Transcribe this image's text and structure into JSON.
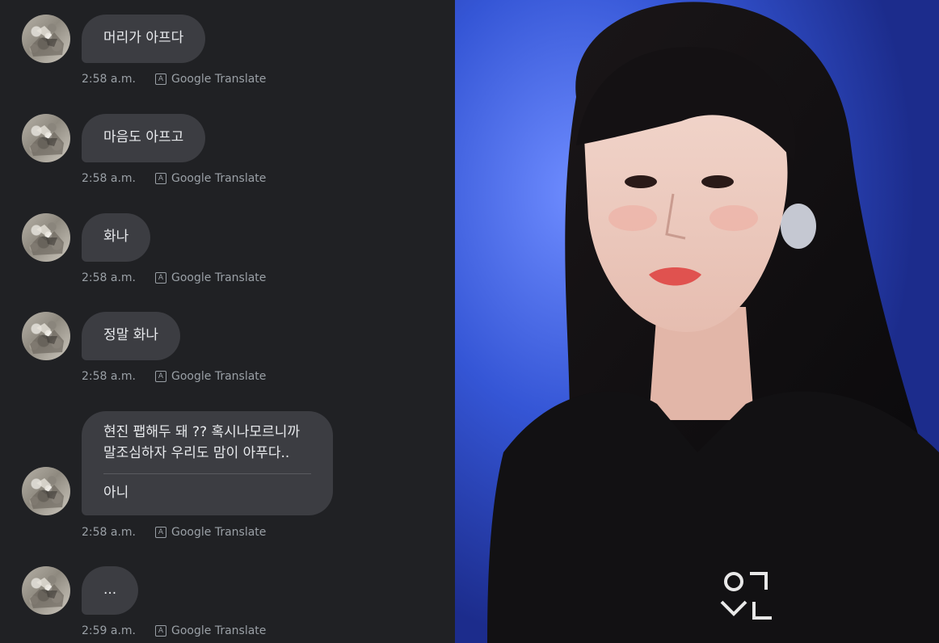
{
  "messages": [
    {
      "text": "머리가 아프다",
      "time": "2:58 a.m.",
      "translate_label": "Google Translate"
    },
    {
      "text": "마음도 아프고",
      "time": "2:58 a.m.",
      "translate_label": "Google Translate"
    },
    {
      "text": "화나",
      "time": "2:58 a.m.",
      "translate_label": "Google Translate"
    },
    {
      "text": "정말 화나",
      "time": "2:58 a.m.",
      "translate_label": "Google Translate"
    },
    {
      "quoted_line1": "현진 팹해두 돼 ?? 혹시나모르니까",
      "quoted_line2": "말조심하자 우리도 맘이 아푸다..",
      "text": "아니",
      "time": "2:58 a.m.",
      "translate_label": "Google Translate"
    },
    {
      "text": "...",
      "time": "2:59 a.m.",
      "translate_label": "Google Translate"
    }
  ],
  "translate_icon_glyph": "A",
  "hoodie_logo": "ㅇㄷ\nㅅㄴ",
  "colors": {
    "chat_background": "#202124",
    "bubble": "#3c3d42",
    "bubble_text": "#e8eaed",
    "meta_text": "#9aa0a6",
    "stage_blue": "#2a49c9"
  },
  "icons": {
    "avatar": "avatar-image",
    "translate": "google-translate-icon"
  }
}
